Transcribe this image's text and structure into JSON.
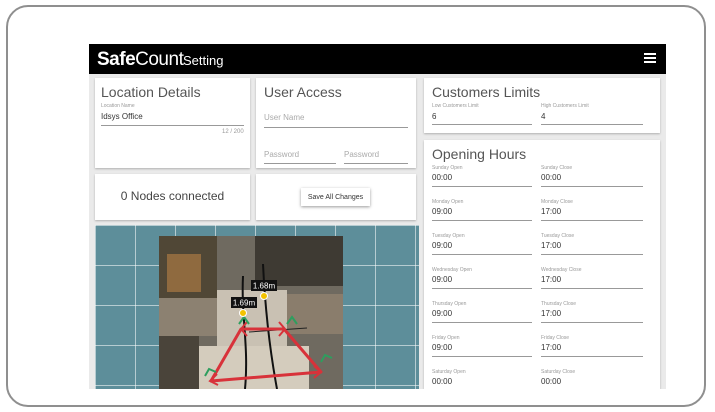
{
  "app": {
    "brand_bold": "Safe",
    "brand_light": "Count",
    "page_name": "Setting"
  },
  "location": {
    "title": "Location Details",
    "name_label": "Location Name",
    "name_value": "Idsys Office",
    "char_count": "12 / 200"
  },
  "user_access": {
    "title": "User Access",
    "username_placeholder": "User Name",
    "password_placeholder": "Password",
    "confirm_placeholder": "Password"
  },
  "nodes": {
    "text": "0 Nodes connected"
  },
  "actions": {
    "save_label": "Save All Changes"
  },
  "limits": {
    "title": "Customers Limits",
    "low_label": "Low Customers Limit",
    "low_value": "6",
    "high_label": "High Customers Limit",
    "high_value": "4"
  },
  "hours": {
    "title": "Opening Hours",
    "days": [
      {
        "open_label": "Sunday Open",
        "open": "00:00",
        "close_label": "Sunday Close",
        "close": "00:00"
      },
      {
        "open_label": "Monday Open",
        "open": "09:00",
        "close_label": "Monday Close",
        "close": "17:00"
      },
      {
        "open_label": "Tuesday Open",
        "open": "09:00",
        "close_label": "Tuesday Close",
        "close": "17:00"
      },
      {
        "open_label": "Wednesday Open",
        "open": "09:00",
        "close_label": "Wednesday Close",
        "close": "17:00"
      },
      {
        "open_label": "Thursday Open",
        "open": "09:00",
        "close_label": "Thursday Close",
        "close": "17:00"
      },
      {
        "open_label": "Friday Open",
        "open": "09:00",
        "close_label": "Friday Close",
        "close": "17:00"
      },
      {
        "open_label": "Saturday Open",
        "open": "00:00",
        "close_label": "Saturday Close",
        "close": "00:00"
      }
    ]
  },
  "map": {
    "sensor_a_height": "1.69m",
    "sensor_b_height": "1.68m"
  },
  "colors": {
    "appbar": "#000000",
    "floor": "#5d8e9a",
    "zone_line": "#d8323a",
    "arrow": "#2e9e5e",
    "sensor": "#f2c200"
  },
  "icons": {
    "menu": "hamburger-menu-icon"
  }
}
